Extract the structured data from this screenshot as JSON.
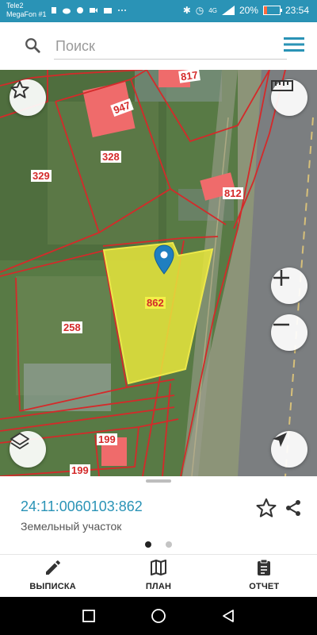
{
  "status_bar": {
    "carrier_1": "Tele2",
    "carrier_2": "MegaFon #1",
    "network": "4G",
    "battery": "20%",
    "battery_level": 0.2,
    "time": "23:54"
  },
  "search": {
    "placeholder": "Поиск"
  },
  "map": {
    "parcel_labels": [
      "817",
      "947",
      "328",
      "329",
      "812",
      "862",
      "258",
      "199",
      "199"
    ],
    "highlight_color": "#e8e63c",
    "boundary_color": "#d42a2a"
  },
  "parcel": {
    "cad_number": "24:11:0060103:862",
    "type": "Земельный участок"
  },
  "pager": {
    "active": 0,
    "count": 2
  },
  "tabs": [
    {
      "label": "ВЫПИСКА",
      "icon": "pencil-icon"
    },
    {
      "label": "ПЛАН",
      "icon": "map-icon"
    },
    {
      "label": "ОТЧЕТ",
      "icon": "clipboard-icon"
    }
  ],
  "colors": {
    "accent": "#2a93b6"
  }
}
